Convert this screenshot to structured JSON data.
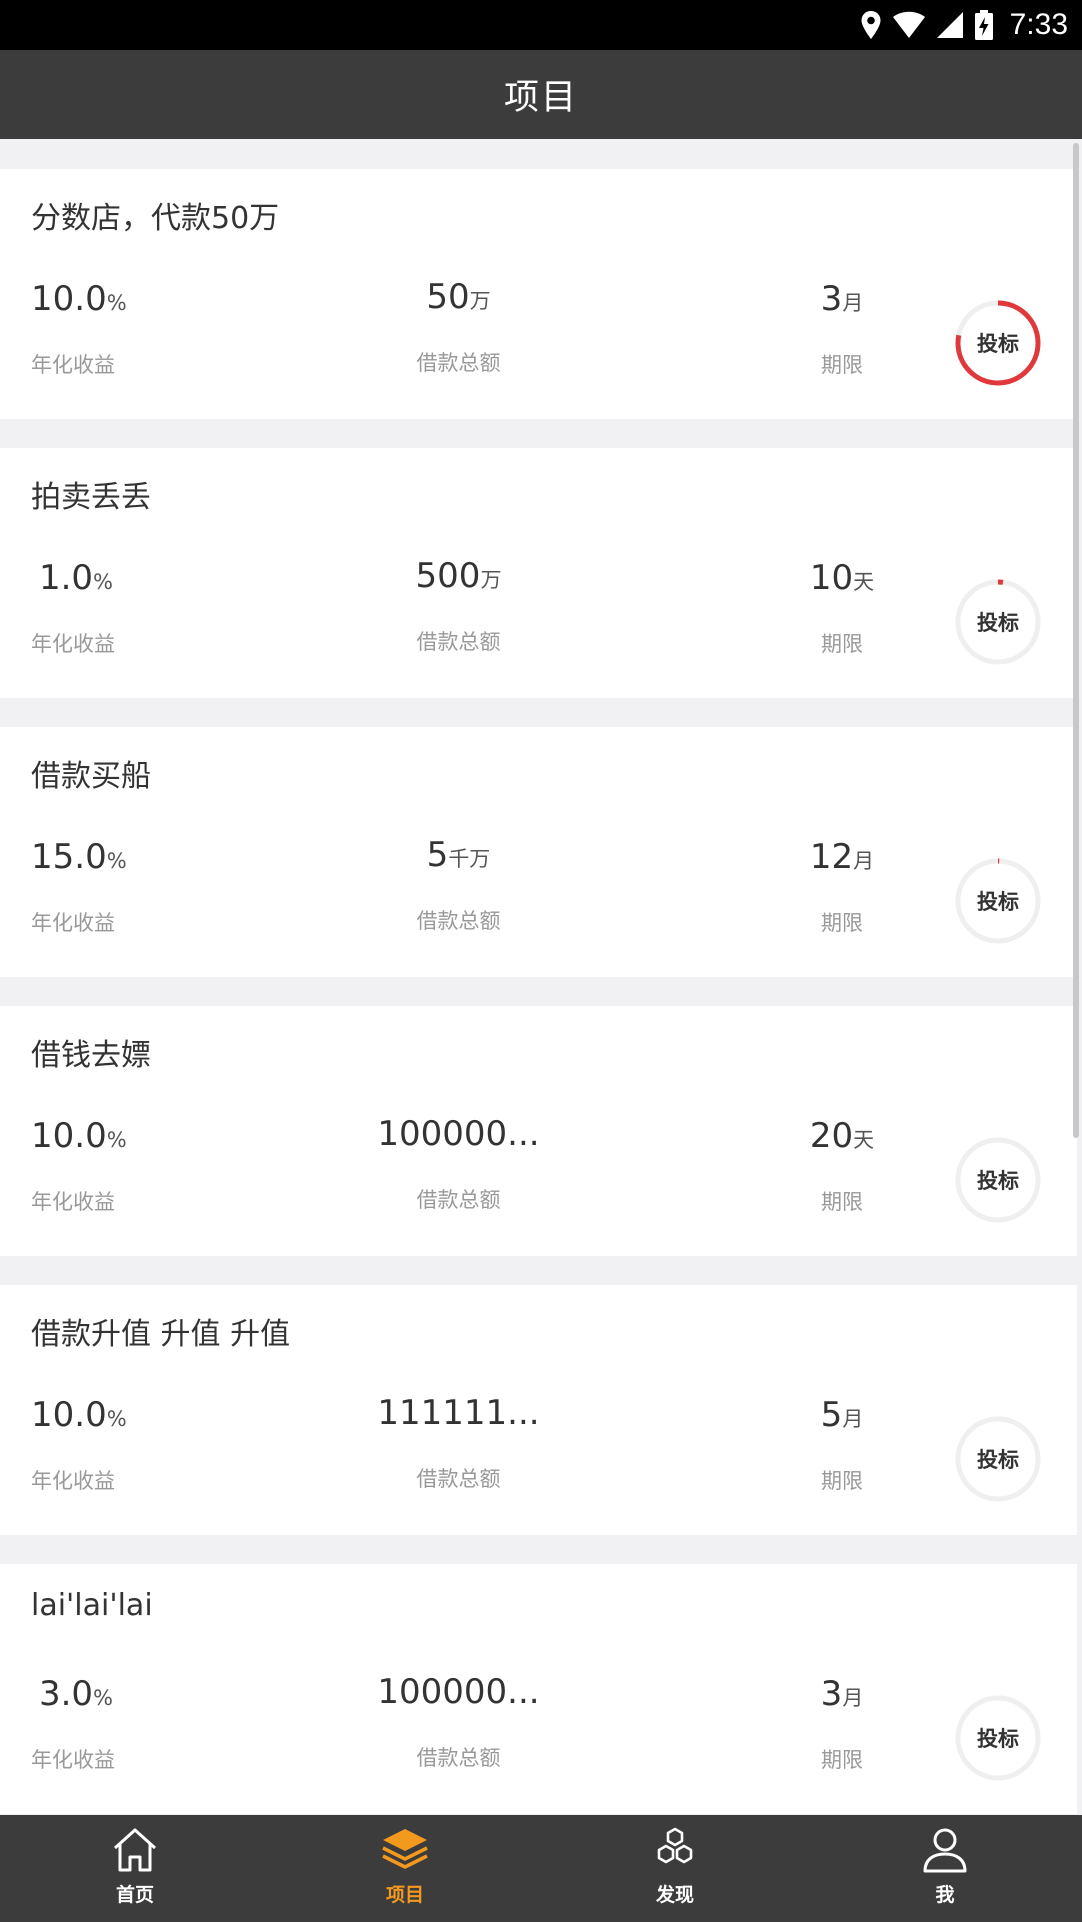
{
  "status_bar": {
    "time": "7:33"
  },
  "header": {
    "title": "项目"
  },
  "labels": {
    "rate": "年化收益",
    "amount": "借款总额",
    "term": "期限",
    "bid": "投标"
  },
  "colors": {
    "accent": "#f39a1e",
    "progress": "#e0393b",
    "track": "#efefef",
    "header_bg": "#3c3c3c"
  },
  "projects": [
    {
      "title": "分数店，代款50万",
      "rate": "10.0",
      "rate_unit": "%",
      "amount": "50",
      "amount_unit": "万",
      "term": "3",
      "term_unit": "月",
      "progress": 0.78
    },
    {
      "title": "拍卖丢丢",
      "rate": "1.0",
      "rate_unit": "%",
      "amount": "500",
      "amount_unit": "万",
      "term": "10",
      "term_unit": "天",
      "progress": 0.02
    },
    {
      "title": "借款买船",
      "rate": "15.0",
      "rate_unit": "%",
      "amount": "5",
      "amount_unit": "千万",
      "term": "12",
      "term_unit": "月",
      "progress": 0.005
    },
    {
      "title": "借钱去嫖",
      "rate": "10.0",
      "rate_unit": "%",
      "amount": "100000...",
      "amount_unit": "",
      "term": "20",
      "term_unit": "天",
      "progress": 0
    },
    {
      "title": "借款升值 升值  升值",
      "rate": "10.0",
      "rate_unit": "%",
      "amount": "111111...",
      "amount_unit": "",
      "term": "5",
      "term_unit": "月",
      "progress": 0
    },
    {
      "title": "lai'lai'lai",
      "rate": "3.0",
      "rate_unit": "%",
      "amount": "100000...",
      "amount_unit": "",
      "term": "3",
      "term_unit": "月",
      "progress": 0
    }
  ],
  "tabs": [
    {
      "label": "首页",
      "icon": "home-icon",
      "active": false
    },
    {
      "label": "项目",
      "icon": "layers-icon",
      "active": true
    },
    {
      "label": "发现",
      "icon": "hexagons-icon",
      "active": false
    },
    {
      "label": "我",
      "icon": "user-icon",
      "active": false
    }
  ]
}
